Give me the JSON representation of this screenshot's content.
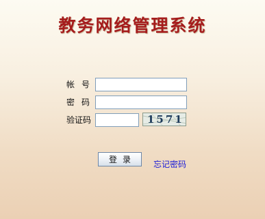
{
  "header": {
    "title": "教务网络管理系统"
  },
  "form": {
    "account_label": "帐号",
    "account_value": "",
    "password_label": "密码",
    "password_value": "",
    "captcha_label": "验证码",
    "captcha_value": "",
    "captcha_image_text": "1571"
  },
  "actions": {
    "login_label": "登录",
    "forgot_password_label": "忘记密码"
  }
}
